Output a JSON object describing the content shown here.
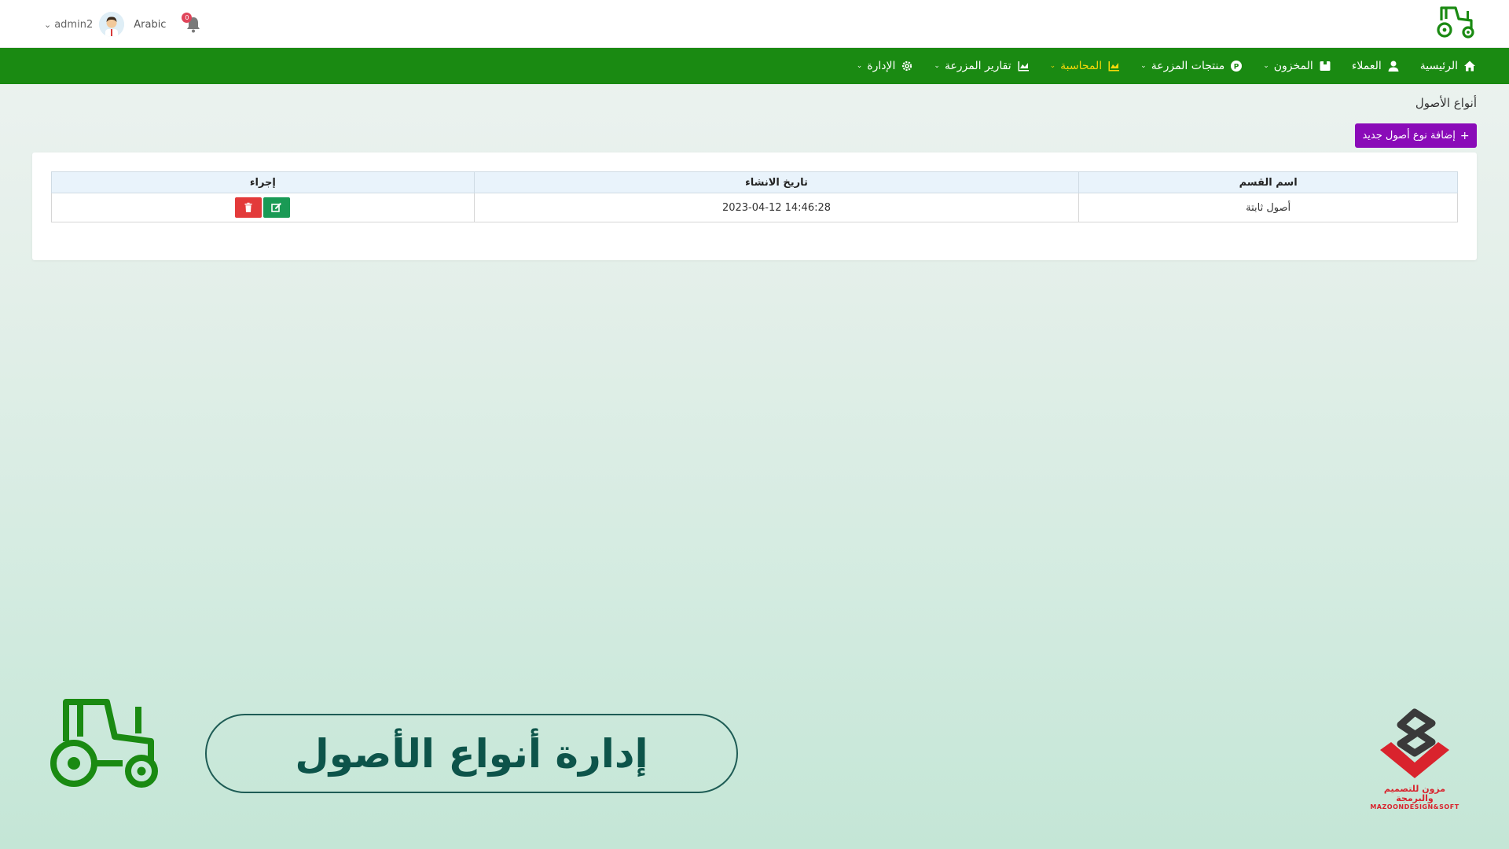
{
  "header": {
    "user_name": "admin2",
    "language": "Arabic",
    "notification_count": "0"
  },
  "nav": {
    "items": [
      {
        "label": "الرئيسية",
        "icon": "home-icon"
      },
      {
        "label": "العملاء",
        "icon": "user-icon"
      },
      {
        "label": "المخزون",
        "icon": "box-icon"
      },
      {
        "label": "منتجات المزرعة",
        "icon": "product-icon"
      },
      {
        "label": "المحاسبة",
        "icon": "chart-icon"
      },
      {
        "label": "تقارير المزرعة",
        "icon": "chart-icon"
      },
      {
        "label": "الإدارة",
        "icon": "gear-icon"
      }
    ],
    "active_color": "#f5d90a"
  },
  "page": {
    "title": "أنواع الأصول",
    "add_button": "إضافة نوع أصول جديد",
    "add_plus": "+"
  },
  "table": {
    "headers": [
      "اسم القسم",
      "تاريخ الانشاء",
      "إجراء"
    ],
    "rows": [
      {
        "name": "أصول ثابتة",
        "created": "2023-04-12 14:46:28"
      }
    ]
  },
  "banner": {
    "text": "إدارة أنواع الأصول"
  },
  "brand": {
    "arabic": "مزون للتصميم والبرمجة",
    "english": "MAZOONDESIGN&SOFT"
  },
  "colors": {
    "nav_bg": "#1a8a12",
    "add_button": "#8a0bb8",
    "edit_button": "#1a9a55",
    "delete_button": "#e33a3a"
  }
}
